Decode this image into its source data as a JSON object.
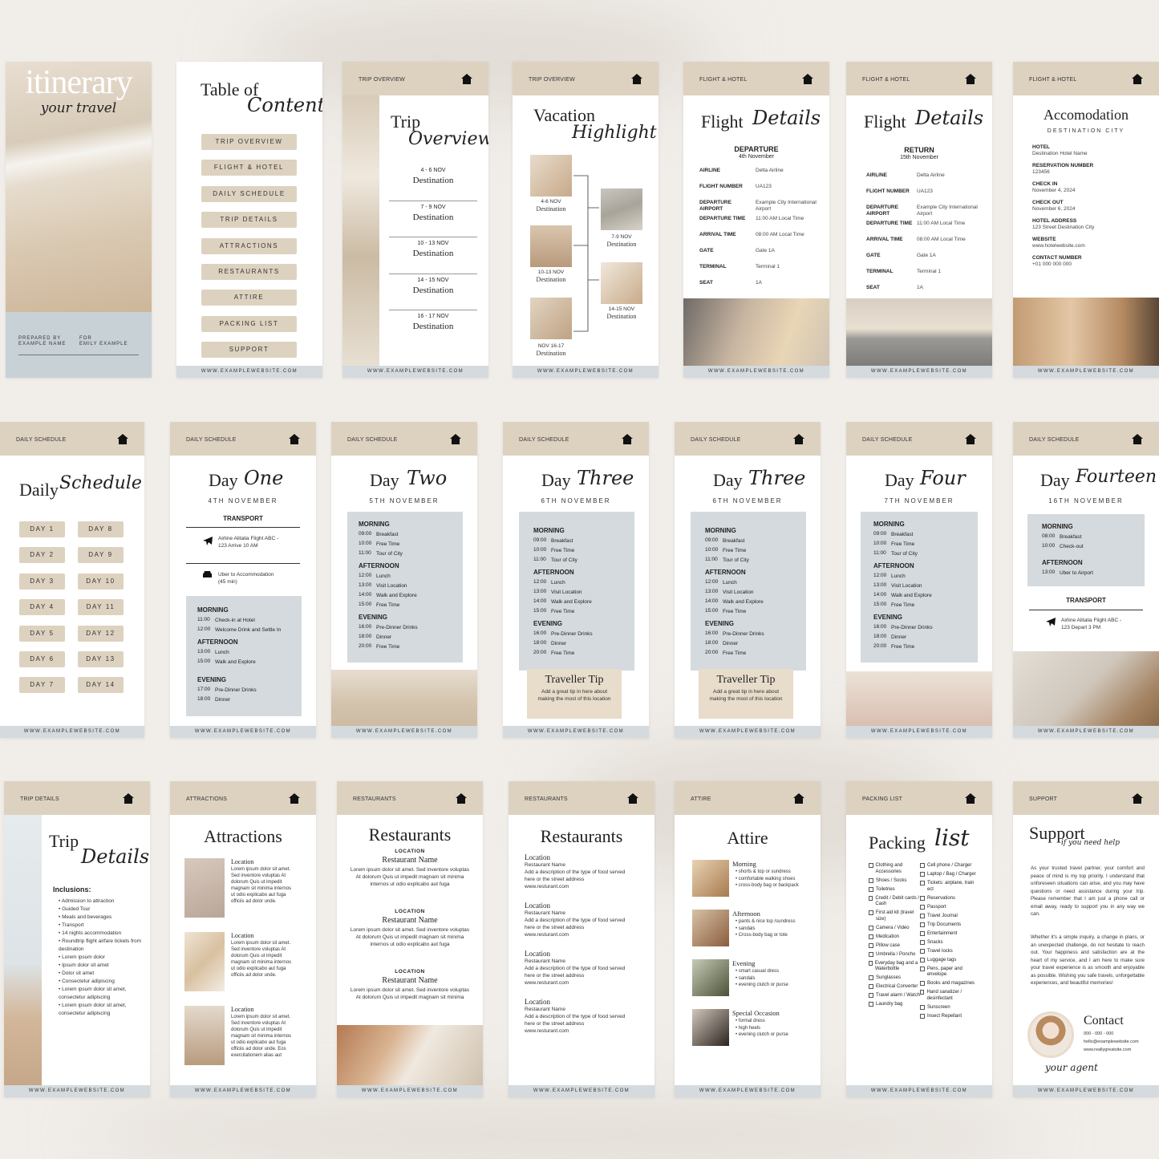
{
  "footer_url": "WWW.EXAMPLEWEBSITE.COM",
  "home_icon": "home-icon",
  "cover": {
    "title": "itinerary",
    "script": "your travel",
    "prepared_label": "PREPARED BY",
    "prepared_name": "EXAMPLE NAME",
    "for_label": "FOR",
    "for_name": "EMILY EXAMPLE"
  },
  "toc": {
    "title_a": "Table of",
    "title_b": "Contents",
    "items": [
      "TRIP OVERVIEW",
      "FLIGHT & HOTEL",
      "DAILY SCHEDULE",
      "TRIP DETAILS",
      "ATTRACTIONS",
      "RESTAURANTS",
      "ATTIRE",
      "PACKING LIST",
      "SUPPORT"
    ]
  },
  "trip_overview": {
    "header": "TRIP OVERVIEW",
    "title_a": "Trip",
    "title_b": "Overview",
    "entries": [
      {
        "dates": "4 - 6 NOV",
        "place": "Destination"
      },
      {
        "dates": "7 - 9 NOV",
        "place": "Destination"
      },
      {
        "dates": "10 - 13 NOV",
        "place": "Destination"
      },
      {
        "dates": "14 - 15 NOV",
        "place": "Destination"
      },
      {
        "dates": "16 - 17 NOV",
        "place": "Destination"
      }
    ]
  },
  "vacation": {
    "header": "TRIP OVERVIEW",
    "title_a": "Vacation",
    "title_b": "Highlight",
    "items": [
      {
        "dates": "4-6 NOV",
        "place": "Destination"
      },
      {
        "dates": "7-9 NOV",
        "place": "Destination"
      },
      {
        "dates": "10-13 NOV",
        "place": "Destination"
      },
      {
        "dates": "14-15 NOV",
        "place": "Destination"
      },
      {
        "dates": "NOV 16-17",
        "place": "Destination"
      }
    ]
  },
  "flight_dep": {
    "header": "FLIGHT & HOTEL",
    "title_a": "Flight",
    "title_b": "Details",
    "heading": "DEPARTURE",
    "date": "4th November",
    "rows": [
      {
        "k": "AIRLINE",
        "v": "Delta Airline"
      },
      {
        "k": "FLIGHT NUMBER",
        "v": "UA123"
      },
      {
        "k": "DEPARTURE AIRPORT",
        "v": "Example City International Airport"
      },
      {
        "k": "DEPARTURE TIME",
        "v": "11:00 AM Local Time"
      },
      {
        "k": "ARRIVAL TIME",
        "v": "08:00 AM Local Time"
      },
      {
        "k": "GATE",
        "v": "Gate 1A"
      },
      {
        "k": "TERMINAL",
        "v": "Terminal 1"
      },
      {
        "k": "SEAT",
        "v": "1A"
      }
    ]
  },
  "flight_ret": {
    "header": "FLIGHT & HOTEL",
    "title_a": "Flight",
    "title_b": "Details",
    "heading": "RETURN",
    "date": "15th November",
    "rows": [
      {
        "k": "AIRLINE",
        "v": "Delta Airline"
      },
      {
        "k": "FLIGHT NUMBER",
        "v": "UA123"
      },
      {
        "k": "DEPARTURE AIRPORT",
        "v": "Example City International Airport"
      },
      {
        "k": "DEPARTURE TIME",
        "v": "11:00 AM Local Time"
      },
      {
        "k": "ARRIVAL TIME",
        "v": "08:00 AM Local Time"
      },
      {
        "k": "GATE",
        "v": "Gate 1A"
      },
      {
        "k": "TERMINAL",
        "v": "Terminal 1"
      },
      {
        "k": "SEAT",
        "v": "1A"
      }
    ]
  },
  "accom": {
    "header": "FLIGHT & HOTEL",
    "title": "Accomodation",
    "sub": "DESTINATION CITY",
    "rows": [
      {
        "k": "HOTEL",
        "v": "Destination Hotel Name"
      },
      {
        "k": "RESERVATION NUMBER",
        "v": "123456"
      },
      {
        "k": "CHECK IN",
        "v": "November 4, 2024"
      },
      {
        "k": "CHECK OUT",
        "v": "November 6, 2024"
      },
      {
        "k": "HOTEL ADDRESS",
        "v": "123 Street Destination City"
      },
      {
        "k": "WEBSITE",
        "v": "www.hotelwebsite.com"
      },
      {
        "k": "CONTACT NUMBER",
        "v": "+01 000 000 000"
      }
    ]
  },
  "daily": {
    "header": "DAILY SCHEDULE",
    "title_a": "Daily",
    "title_b": "Schedule",
    "left": [
      "DAY 1",
      "DAY 2",
      "DAY 3",
      "DAY 4",
      "DAY 5",
      "DAY 6",
      "DAY 7"
    ],
    "right": [
      "DAY 8",
      "DAY 9",
      "DAY 10",
      "DAY 11",
      "DAY 12",
      "DAY 13",
      "DAY 14"
    ]
  },
  "day_one": {
    "header": "DAILY SCHEDULE",
    "title_a": "Day",
    "title_b": "One",
    "date": "4TH NOVEMBER",
    "transport": "TRANSPORT",
    "flight": "Airline Alitalia Flight ABC - 123 Arrive 10 AM",
    "car": "Uber to Accommodation (45 min)",
    "morning": "MORNING",
    "m_items": [
      {
        "t": "11:00",
        "a": "Check-in at Hotel"
      },
      {
        "t": "12:00",
        "a": "Welcome Drink and Settle In"
      }
    ],
    "afternoon": "AFTERNOON",
    "a_items": [
      {
        "t": "13:00",
        "a": "Lunch"
      },
      {
        "t": "15:00",
        "a": "Walk and Explore"
      }
    ],
    "evening": "EVENING",
    "e_items": [
      {
        "t": "17:00",
        "a": "Pre-Dinner Drinks"
      },
      {
        "t": "18:00",
        "a": "Dinner"
      }
    ]
  },
  "day_two": {
    "header": "DAILY SCHEDULE",
    "title_a": "Day",
    "title_b": "Two",
    "date": "5TH NOVEMBER",
    "morning": "MORNING",
    "m_items": [
      {
        "t": "09:00",
        "a": "Breakfast"
      },
      {
        "t": "10:00",
        "a": "Free Time"
      },
      {
        "t": "11:00",
        "a": "Tour of City"
      }
    ],
    "afternoon": "AFTERNOON",
    "a_items": [
      {
        "t": "12:00",
        "a": "Lunch"
      },
      {
        "t": "13:00",
        "a": "Visit Location"
      },
      {
        "t": "14:00",
        "a": "Walk and Explore"
      },
      {
        "t": "15:00",
        "a": "Free Time"
      }
    ],
    "evening": "EVENING",
    "e_items": [
      {
        "t": "16:00",
        "a": "Pre-Dinner Drinks"
      },
      {
        "t": "18:00",
        "a": "Dinner"
      },
      {
        "t": "20:00",
        "a": "Free Time"
      }
    ]
  },
  "day_three_a": {
    "header": "DAILY SCHEDULE",
    "title_a": "Day",
    "title_b": "Three",
    "date": "6TH NOVEMBER",
    "morning": "MORNING",
    "m_items": [
      {
        "t": "09:00",
        "a": "Breakfast"
      },
      {
        "t": "10:00",
        "a": "Free Time"
      },
      {
        "t": "11:00",
        "a": "Tour of City"
      }
    ],
    "afternoon": "AFTERNOON",
    "a_items": [
      {
        "t": "12:00",
        "a": "Lunch"
      },
      {
        "t": "13:00",
        "a": "Visit Location"
      },
      {
        "t": "14:00",
        "a": "Walk and Explore"
      },
      {
        "t": "15:00",
        "a": "Free Time"
      }
    ],
    "evening": "EVENING",
    "e_items": [
      {
        "t": "16:00",
        "a": "Pre-Dinner Drinks"
      },
      {
        "t": "18:00",
        "a": "Dinner"
      },
      {
        "t": "20:00",
        "a": "Free Time"
      }
    ],
    "tip_title": "Traveller Tip",
    "tip_text": "Add a great tip in here about making the most of this location"
  },
  "day_three_b": {
    "header": "DAILY SCHEDULE",
    "title_a": "Day",
    "title_b": "Three",
    "date": "6TH NOVEMBER",
    "morning": "MORNING",
    "m_items": [
      {
        "t": "09:00",
        "a": "Breakfast"
      },
      {
        "t": "10:00",
        "a": "Free Time"
      },
      {
        "t": "11:00",
        "a": "Tour of City"
      }
    ],
    "afternoon": "AFTERNOON",
    "a_items": [
      {
        "t": "12:00",
        "a": "Lunch"
      },
      {
        "t": "13:00",
        "a": "Visit Location"
      },
      {
        "t": "14:00",
        "a": "Walk and Explore"
      },
      {
        "t": "15:00",
        "a": "Free Time"
      }
    ],
    "evening": "EVENING",
    "e_items": [
      {
        "t": "16:00",
        "a": "Pre-Dinner Drinks"
      },
      {
        "t": "18:00",
        "a": "Dinner"
      },
      {
        "t": "20:00",
        "a": "Free Time"
      }
    ],
    "tip_title": "Traveller Tip",
    "tip_text": "Add a great tip in here about making the most of this location"
  },
  "day_four": {
    "header": "DAILY SCHEDULE",
    "title_a": "Day",
    "title_b": "Four",
    "date": "7TH NOVEMBER",
    "morning": "MORNING",
    "m_items": [
      {
        "t": "09:00",
        "a": "Breakfast"
      },
      {
        "t": "10:00",
        "a": "Free Time"
      },
      {
        "t": "11:00",
        "a": "Tour of City"
      }
    ],
    "afternoon": "AFTERNOON",
    "a_items": [
      {
        "t": "12:00",
        "a": "Lunch"
      },
      {
        "t": "13:00",
        "a": "Visit Location"
      },
      {
        "t": "14:00",
        "a": "Walk and Explore"
      },
      {
        "t": "15:00",
        "a": "Free Time"
      }
    ],
    "evening": "EVENING",
    "e_items": [
      {
        "t": "16:00",
        "a": "Pre-Dinner Drinks"
      },
      {
        "t": "18:00",
        "a": "Dinner"
      },
      {
        "t": "20:00",
        "a": "Free Time"
      }
    ]
  },
  "day_fourteen": {
    "header": "DAILY SCHEDULE",
    "title_a": "Day",
    "title_b": "Fourteen",
    "date": "16TH NOVEMBER",
    "morning": "MORNING",
    "m_items": [
      {
        "t": "08:00",
        "a": "Breakfast"
      },
      {
        "t": "10:00",
        "a": "Check-out"
      }
    ],
    "afternoon": "AFTERNOON",
    "a_items": [
      {
        "t": "13:00",
        "a": "Uber to Airport"
      }
    ],
    "transport": "TRANSPORT",
    "flight": "Airline Alitalia Flight ABC - 123 Depart 3 PM"
  },
  "trip_details": {
    "header": "TRIP DETAILS",
    "title_a": "Trip",
    "title_b": "Details",
    "incl": "Inclusions:",
    "items": [
      "Admission to attraction",
      "Guided Tour",
      "Meals and beverages",
      "Transport",
      "14 nights accommodation",
      "Roundtrip flight airfare tickets from destination",
      "Lorem ipsum dolor",
      "Ipsum dolor sit amet",
      "Dolor sit amet",
      "Consectetur adipiscing",
      "Lorem ipsum dolor sit amet, consectetur adipiscing",
      "Lorem ipsum dolor sit amet, consectetur adipiscing"
    ]
  },
  "attractions": {
    "header": "ATTRACTIONS",
    "title": "Attractions",
    "items": [
      {
        "t": "Location",
        "d": "Lorem ipsum dolor sit amet. Sed inventore voluptas At dolorum Quis ut impedit magnam sit minima internos ut odio explicabo aut fuga officiis ad dolor unde."
      },
      {
        "t": "Location",
        "d": "Lorem ipsum dolor sit amet. Sed inventore voluptas At dolorum Quis ut impedit magnam sit minima internos ut odio explicabo aut fuga officiis ad dolor unde."
      },
      {
        "t": "Location",
        "d": "Lorem ipsum dolor sit amet. Sed inventore voluptas At dolorum Quis ut impedit magnam sit minima internos ut odio explicabo aut fuga officiis ad dolor unde. Eos exercitationem alias aut"
      }
    ]
  },
  "restaurants_a": {
    "header": "RESTAURANTS",
    "title": "Restaurants",
    "items": [
      {
        "loc": "LOCATION",
        "name": "Restaurant Name",
        "d": "Lorem ipsum dolor sit amet. Sed inventore voluptas At dolorum Quis ut impedit magnam sit minima internos ut odio explicabo aut fuga"
      },
      {
        "loc": "LOCATION",
        "name": "Restaurant Name",
        "d": "Lorem ipsum dolor sit amet. Sed inventore voluptas At dolorum Quis ut impedit magnam sit minima internos ut odio explicabo aut fuga"
      },
      {
        "loc": "LOCATION",
        "name": "Restaurant Name",
        "d": "Lorem ipsum dolor sit amet. Sed inventore voluptas At dolorum Quis ut impedit magnam sit minima"
      }
    ]
  },
  "restaurants_b": {
    "header": "RESTAURANTS",
    "title": "Restaurants",
    "items": [
      {
        "loc": "Location",
        "name": "Restaurant Name",
        "d": "Add a description of the type of food served here or the street address",
        "url": "www.resturant.com"
      },
      {
        "loc": "Location",
        "name": "Restaurant Name",
        "d": "Add a description of the type of food served here or the street address",
        "url": "www.resturant.com"
      },
      {
        "loc": "Location",
        "name": "Restaurant Name",
        "d": "Add a description of the type of food served here or the street address",
        "url": "www.resturant.com"
      },
      {
        "loc": "Location",
        "name": "Restaurant Name",
        "d": "Add a description of the type of food served here or the street address",
        "url": "www.resturant.com"
      }
    ]
  },
  "attire": {
    "header": "ATTIRE",
    "title": "Attire",
    "items": [
      {
        "t": "Morning",
        "l": [
          "shorts & top or sundress",
          "comfortable walking shoes",
          "cross-body bag or backpack"
        ]
      },
      {
        "t": "Afternoon",
        "l": [
          "pants & nice top /sundress",
          "sandals",
          "Cross-body bag or tote"
        ]
      },
      {
        "t": "Evening",
        "l": [
          "smart casual dress",
          "sandals",
          "evening clutch or purse"
        ]
      },
      {
        "t": "Special Occasion",
        "l": [
          "formal dress",
          "high heels",
          "evening clutch or purse"
        ]
      }
    ]
  },
  "packing": {
    "header": "PACKING LIST",
    "title_a": "Packing",
    "title_b": "list",
    "left": [
      "Clothing and Accessories",
      "Shoes / Socks",
      "Toiletries",
      "Credit / Debit cards / Cash",
      "First aid kit (travel size)",
      "Camera / Video",
      "Medication",
      "Pillow case",
      "Umbrella / Poncho",
      "Everyday bag and a Waterbottle",
      "Sunglasses",
      "Electrical Converter",
      "Travel alarm / Watch",
      "Laundry bag"
    ],
    "right": [
      "Cell phone / Charger",
      "Laptop / Bag / Charger",
      "Tickets: airplane, train ect",
      "Reservations",
      "Passport",
      "Travel Journal",
      "Trip Documents",
      "Entertainment",
      "Snacks",
      "Travel locks",
      "Luggage tags",
      "Pens, paper and envelope",
      "Books and magazines",
      "Hand sanatizer / desinfectant",
      "Sunscreen",
      "Insect Repellant"
    ]
  },
  "support": {
    "header": "SUPPORT",
    "title": "Support",
    "script": "if you need help",
    "p1": "As your trusted travel partner, your comfort and peace of mind is my top priority. I understand that unforeseen situations can arise, and you may have questions or need assistance during your trip. Please remember that I am just a phone call or email away, ready to support you in any way we can.",
    "p2": "Whether it's a simple inquiry, a change in plans, or an unexpected challenge, do not hesitate to reach out. Your happiness and satisfaction are at the heart of my service, and I am here to make sure your travel experience is as smooth and enjoyable as possible. Wishing you safe travels, unforgettable experiences, and beautiful memories!",
    "contact": "Contact",
    "phone": "000 - 000 - 000",
    "email": "hello@examplewebsite.com",
    "web": "www.reallygreatsite.com",
    "sign": "your agent"
  },
  "colors": {
    "beige": "#ddd2c0",
    "blue_grey": "#d4dadd",
    "sand": "#e8dccb"
  }
}
